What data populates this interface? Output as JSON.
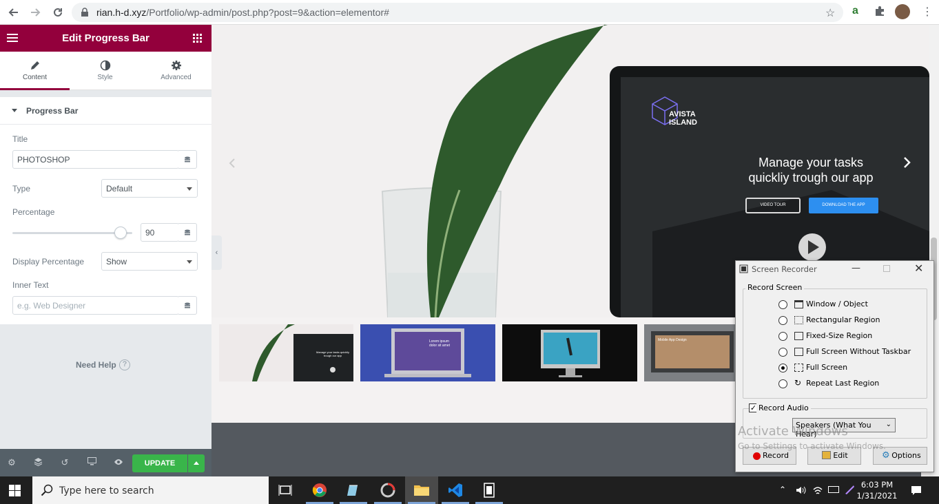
{
  "browser": {
    "url_host": "rian.h-d.xyz",
    "url_path": "/Portfolio/wp-admin/post.php?post=9&action=elementor#"
  },
  "panel": {
    "title": "Edit Progress Bar",
    "tabs": [
      {
        "label": "Content",
        "icon": "pencil-icon"
      },
      {
        "label": "Style",
        "icon": "contrast-icon"
      },
      {
        "label": "Advanced",
        "icon": "gear-icon"
      }
    ],
    "section_title": "Progress Bar",
    "fields": {
      "title_label": "Title",
      "title_value": "PHOTOSHOP",
      "type_label": "Type",
      "type_value": "Default",
      "percentage_label": "Percentage",
      "percentage_value": "90",
      "percentage_fraction": 0.9,
      "display_percentage_label": "Display Percentage",
      "display_percentage_value": "Show",
      "inner_text_label": "Inner Text",
      "inner_text_placeholder": "e.g. Web Designer"
    },
    "help_label": "Need Help",
    "update_label": "UPDATE"
  },
  "canvas": {
    "hero_brand_line1": "AVISTA",
    "hero_brand_line2": "ISLAND",
    "hero_heading_line1": "Manage your tasks",
    "hero_heading_line2": "quickliy trough our app",
    "btn_video_tour": "VIDEO TOUR",
    "btn_download": "DOWNLOAD THE APP",
    "thumb_1_heading": "Manage your tasks quickliy trough our app",
    "thumb_2_heading": "Lorem ipsum dolor sit amet",
    "thumb_4_heading": "Mobile App Design"
  },
  "recorder": {
    "title": "Screen Recorder",
    "group_label": "Record Screen",
    "options": [
      {
        "label": "Window / Object",
        "icon": "window-icon",
        "selected": false
      },
      {
        "label": "Rectangular Region",
        "icon": "dashed-rect-icon",
        "selected": false
      },
      {
        "label": "Fixed-Size Region",
        "icon": "fixed-rect-icon",
        "selected": false
      },
      {
        "label": "Full Screen Without Taskbar",
        "icon": "screen-icon",
        "selected": false
      },
      {
        "label": "Full Screen",
        "icon": "fullscreen-icon",
        "selected": true
      },
      {
        "label": "Repeat Last Region",
        "icon": "repeat-icon",
        "selected": false
      }
    ],
    "record_audio_label": "Record Audio",
    "record_audio_checked": true,
    "audio_device": "Speakers (What You Hear)",
    "btn_record": "Record",
    "btn_edit": "Edit",
    "btn_options": "Options"
  },
  "watermark": {
    "line1": "Activate Windows",
    "line2": "Go to Settings to activate Windows."
  },
  "taskbar": {
    "search_placeholder": "Type here to search",
    "time": "6:03 PM",
    "date": "1/31/2021"
  },
  "colors": {
    "elementor_accent": "#93003c",
    "update_green": "#39b54a",
    "download_blue": "#2d8ff0"
  }
}
